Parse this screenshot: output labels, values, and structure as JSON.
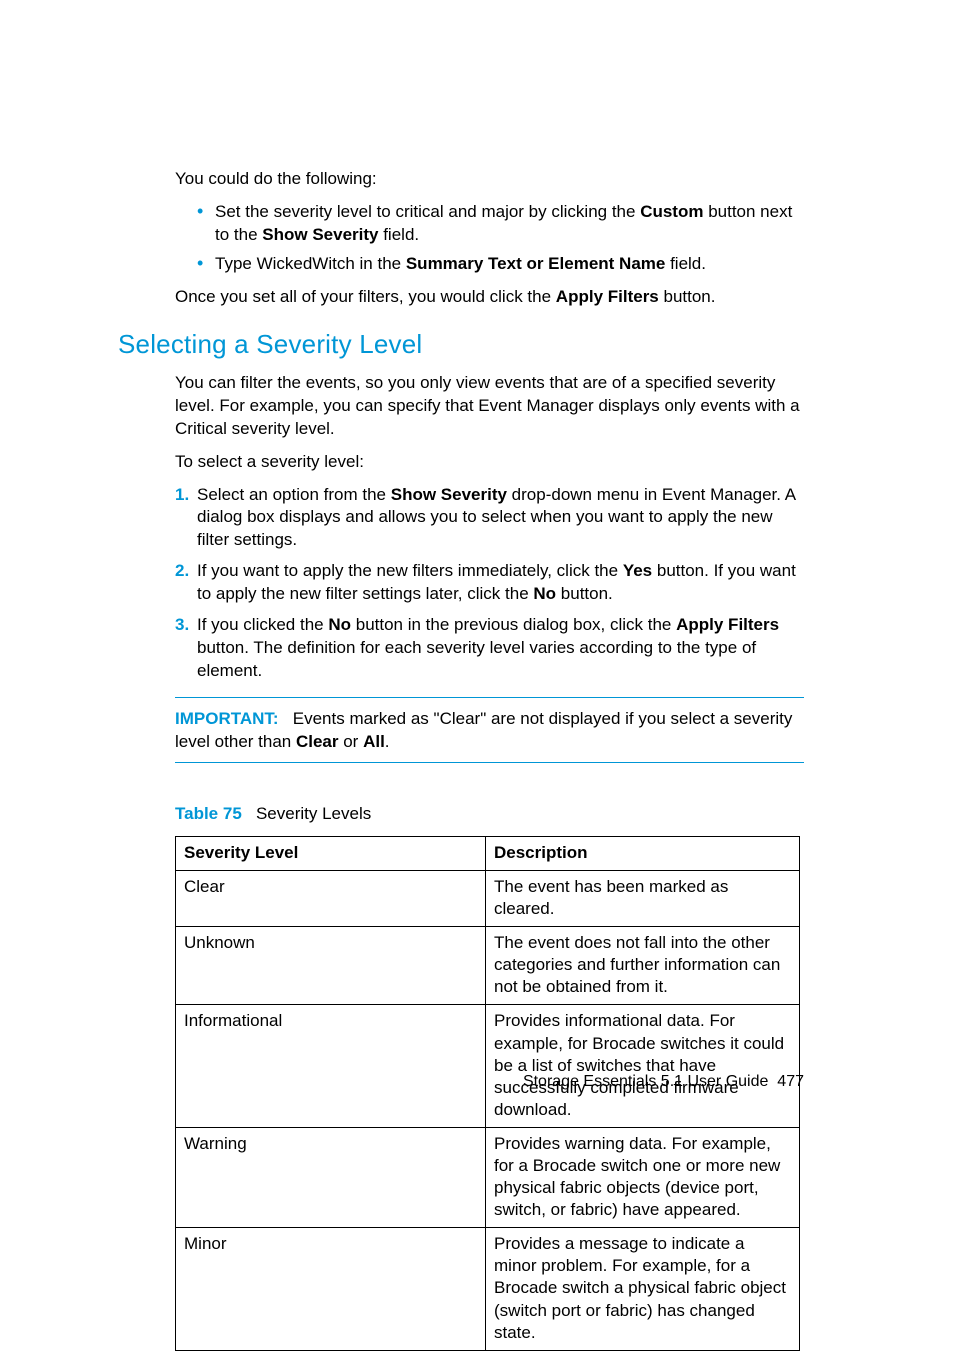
{
  "intro": {
    "p1": "You could do the following:",
    "bullets": [
      {
        "pre": "Set the severity level to critical and major by clicking the ",
        "b1": "Custom",
        "mid": " button next to the ",
        "b2": "Show Severity",
        "post": " field."
      },
      {
        "pre": "Type WickedWitch in the ",
        "b1": "Summary Text or Element Name",
        "post": " field."
      }
    ],
    "p2_pre": "Once you set all of your filters, you would click the ",
    "p2_bold": "Apply Filters",
    "p2_post": " button."
  },
  "heading": "Selecting a Severity Level",
  "sec": {
    "p1": "You can filter the events, so you only view events that are of a specified severity level. For example, you can specify that Event Manager displays only events with a Critical severity level.",
    "p2": "To select a severity level:",
    "steps": [
      {
        "pre": "Select an option from the ",
        "b1": "Show Severity",
        "post": " drop-down menu in Event Manager. A dialog box displays and allows you to select when you want to apply the new filter settings."
      },
      {
        "pre": "If you want to apply the new filters immediately, click the ",
        "b1": "Yes",
        "mid": " button. If you want to apply the new filter settings later, click the ",
        "b2": "No",
        "post": " button."
      },
      {
        "pre": "If you clicked the ",
        "b1": "No",
        "mid": " button in the previous dialog box, click the ",
        "b2": "Apply Filters",
        "post": " button. The definition for each severity level varies according to the type of element."
      }
    ]
  },
  "note": {
    "label": "IMPORTANT:",
    "pre": "Events marked as \"Clear\" are not displayed if you select a severity level other than ",
    "b1": "Clear",
    "mid": " or ",
    "b2": "All",
    "post": "."
  },
  "table": {
    "label": "Table 75",
    "caption": "Severity Levels",
    "headers": [
      "Severity Level",
      "Description"
    ],
    "rows": [
      [
        "Clear",
        "The event has been marked as cleared."
      ],
      [
        "Unknown",
        "The event does not fall into the other categories and further information can not be obtained from it."
      ],
      [
        "Informational",
        "Provides informational data. For example, for Brocade switches it could be a list of switches that have successfully completed firmware download."
      ],
      [
        "Warning",
        "Provides warning data. For example, for a Brocade switch one or more new physical fabric objects (device port, switch, or fabric) have appeared."
      ],
      [
        "Minor",
        "Provides a message to indicate a minor problem. For example, for a Brocade switch a physical fabric object (switch port or fabric) has changed state."
      ]
    ]
  },
  "footer": {
    "title": "Storage Essentials 5.1 User Guide",
    "page": "477"
  }
}
